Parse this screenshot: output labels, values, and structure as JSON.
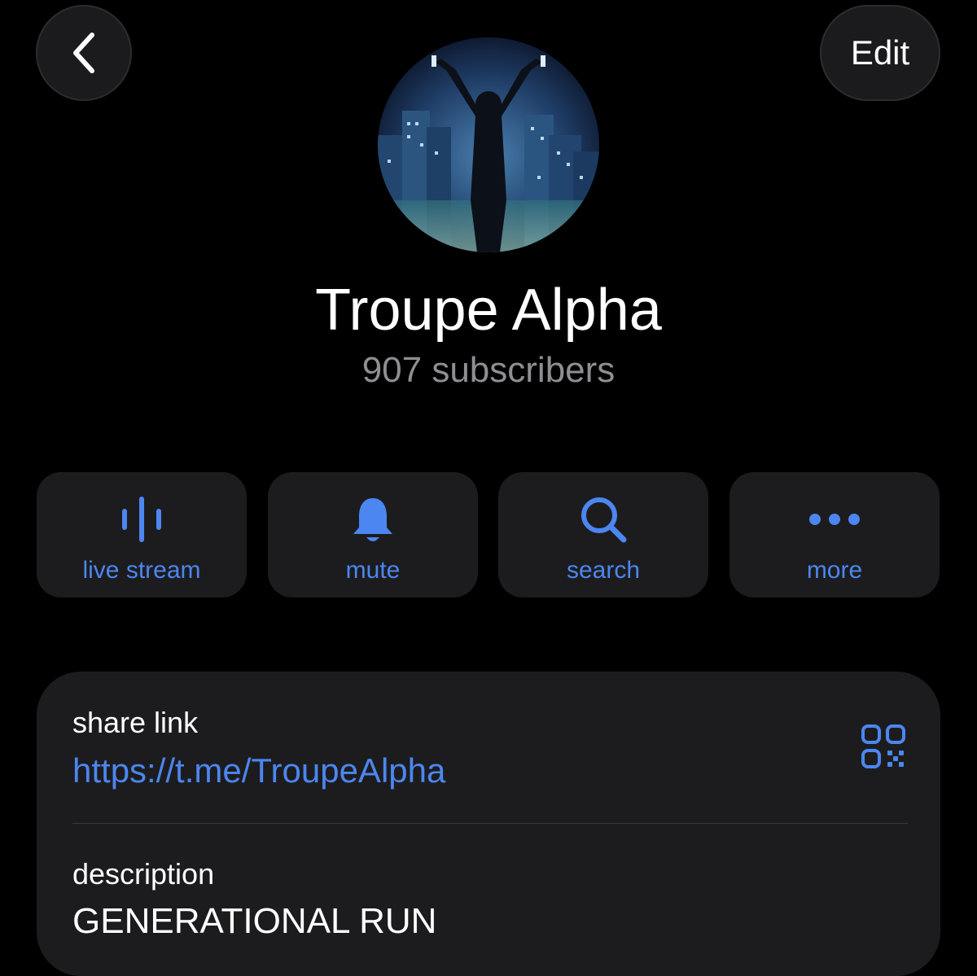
{
  "header": {
    "back_icon": "chevron-left-icon",
    "edit_label": "Edit"
  },
  "channel": {
    "name": "Troupe Alpha",
    "subscribers": "907 subscribers"
  },
  "actions": [
    {
      "label": "live stream",
      "icon": "audio-wave-icon"
    },
    {
      "label": "mute",
      "icon": "bell-icon"
    },
    {
      "label": "search",
      "icon": "search-icon"
    },
    {
      "label": "more",
      "icon": "more-dots-icon"
    }
  ],
  "info": {
    "share_label": "share link",
    "share_url": "https://t.me/TroupeAlpha",
    "description_label": "description",
    "description": "GENERATIONAL RUN"
  },
  "colors": {
    "accent": "#4c86f0",
    "background": "#000000",
    "card": "#1c1c1e",
    "secondary_text": "#8e8e93"
  }
}
